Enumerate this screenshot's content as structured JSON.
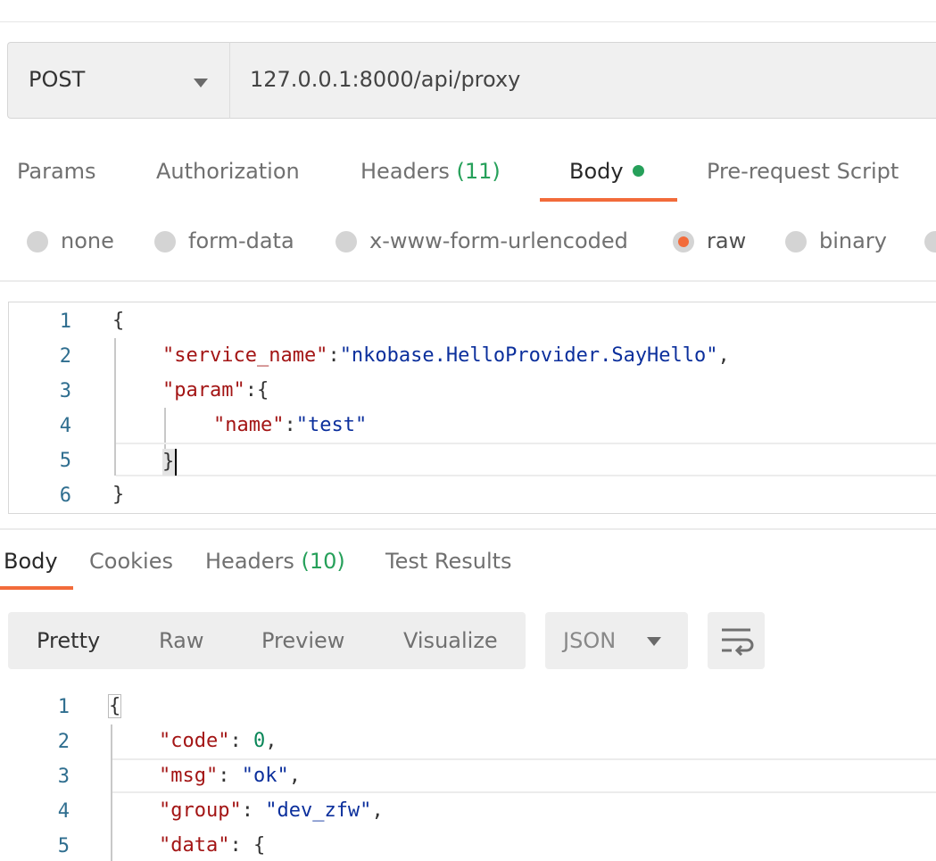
{
  "request": {
    "method": "POST",
    "url": "127.0.0.1:8000/api/proxy"
  },
  "request_tabs": {
    "params": "Params",
    "authorization": "Authorization",
    "headers": "Headers",
    "headers_count": "(11)",
    "body": "Body",
    "pre_request": "Pre-request Script"
  },
  "body_types": {
    "none": "none",
    "form_data": "form-data",
    "urlencoded": "x-www-form-urlencoded",
    "raw": "raw",
    "binary": "binary",
    "selected": "raw"
  },
  "request_body": {
    "line_numbers": [
      "1",
      "2",
      "3",
      "4",
      "5",
      "6"
    ],
    "lines": {
      "l1": "{",
      "l2_key": "\"service_name\"",
      "l2_colon": ":",
      "l2_val": "\"nkobase.HelloProvider.SayHello\"",
      "l2_comma": ",",
      "l3_key": "\"param\"",
      "l3_rest": ":{",
      "l4_key": "\"name\"",
      "l4_colon": ":",
      "l4_val": "\"test\"",
      "l5": "}",
      "l6": "}"
    }
  },
  "response_tabs": {
    "body": "Body",
    "cookies": "Cookies",
    "headers": "Headers",
    "headers_count": "(10)",
    "test_results": "Test Results"
  },
  "view_modes": {
    "pretty": "Pretty",
    "raw": "Raw",
    "preview": "Preview",
    "visualize": "Visualize",
    "format": "JSON"
  },
  "response_body": {
    "line_numbers": [
      "1",
      "2",
      "3",
      "4",
      "5"
    ],
    "lines": {
      "l1": "{",
      "l2_key": "\"code\"",
      "l2_colon": ": ",
      "l2_val": "0",
      "l2_comma": ",",
      "l3_key": "\"msg\"",
      "l3_colon": ": ",
      "l3_val": "\"ok\"",
      "l3_comma": ",",
      "l4_key": "\"group\"",
      "l4_colon": ": ",
      "l4_val": "\"dev_zfw\"",
      "l4_comma": ",",
      "l5_key": "\"data\"",
      "l5_rest": ": {"
    }
  },
  "colors": {
    "accent": "#f26b3a",
    "count_green": "#26a05a",
    "json_key": "#a31515",
    "json_string": "#0b2f9c",
    "json_number": "#098658"
  },
  "icons": {
    "method_caret": "chevron-down-icon",
    "format_caret": "chevron-down-icon",
    "wrap": "wrap-lines-icon",
    "body_status_dot": "green-dot-icon"
  }
}
